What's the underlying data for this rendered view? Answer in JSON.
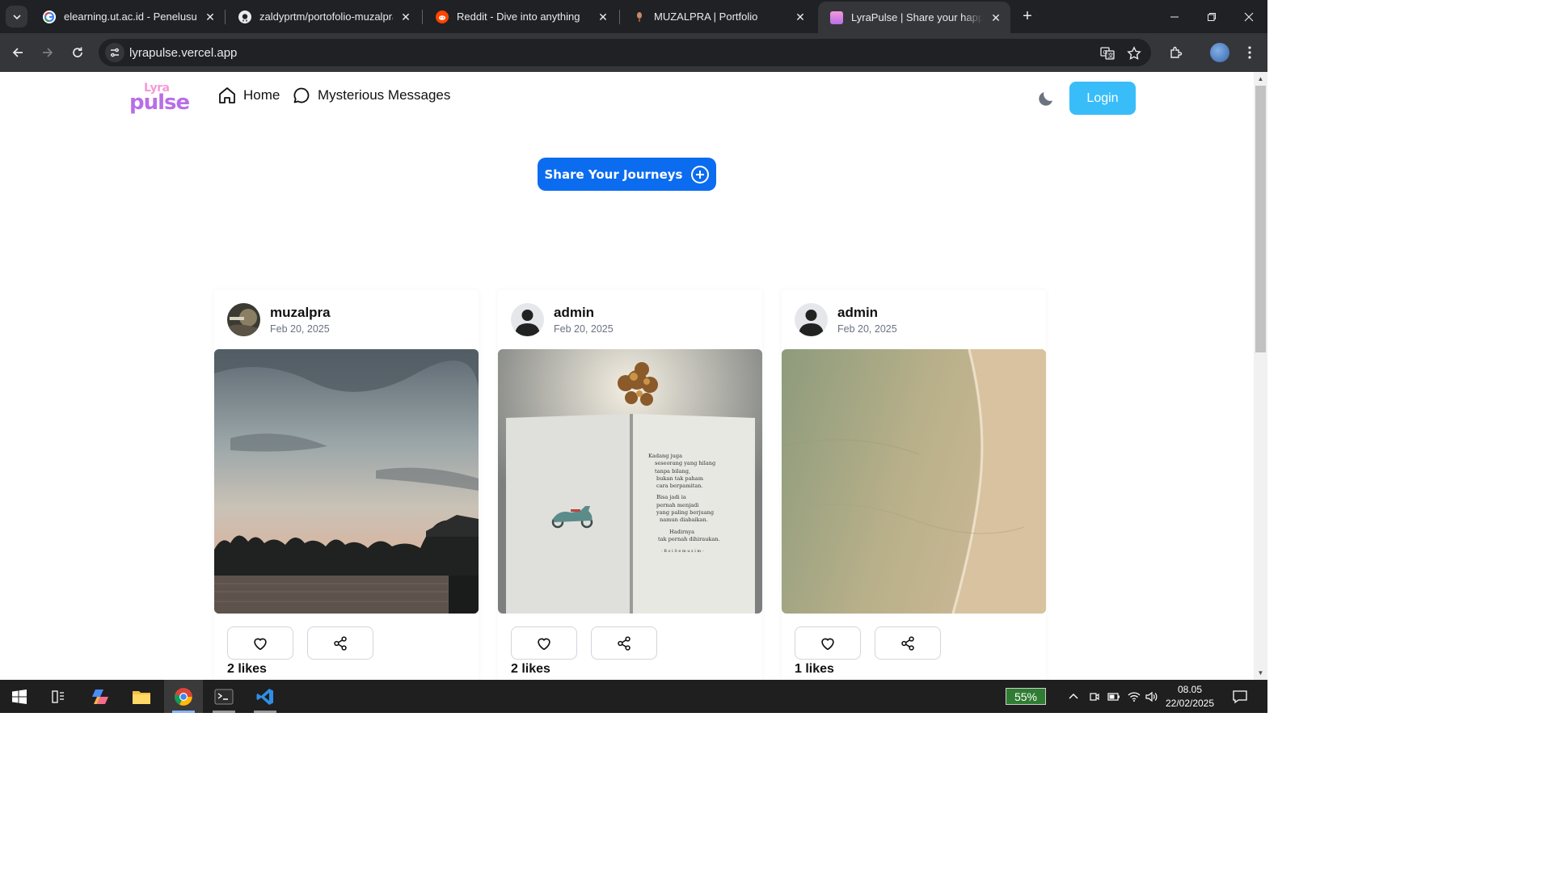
{
  "browser": {
    "tabs": [
      {
        "title": "elearning.ut.ac.id - Penelusuran",
        "favicon": "google-icon"
      },
      {
        "title": "zaldyprtm/portofolio-muzalpra",
        "favicon": "github-icon"
      },
      {
        "title": "Reddit - Dive into anything",
        "favicon": "reddit-icon"
      },
      {
        "title": "MUZALPRA | Portfolio",
        "favicon": "portfolio-icon"
      },
      {
        "title": "LyraPulse | Share your happines",
        "favicon": "lyrapulse-icon",
        "active": true
      }
    ],
    "url": "lyrapulse.vercel.app"
  },
  "site": {
    "logo_top": "Lyra",
    "logo_bottom": "pulse",
    "nav": {
      "home": "Home",
      "messages": "Mysterious Messages"
    },
    "login_label": "Login",
    "share_label": "Share Your Journeys"
  },
  "posts": [
    {
      "username": "muzalpra",
      "date": "Feb 20, 2025",
      "likes": "2 likes",
      "image": "sunset-beach-photo"
    },
    {
      "username": "admin",
      "date": "Feb 20, 2025",
      "likes": "2 likes",
      "image": "open-book-poem-photo"
    },
    {
      "username": "admin",
      "date": "Feb 20, 2025",
      "likes": "1 likes",
      "image": "aerial-shore-photo"
    }
  ],
  "poem_lines": [
    "Kadang juga",
    "seseorang yang hilang",
    "tanpa bilang,",
    "bukan tak paham",
    "cara berpamitan.",
    "Bisa jadi ia",
    "pernah menjadi",
    "yang paling berjuang",
    "namun diabaikan.",
    "Hadirnya",
    "tak pernah dihiraukan.",
    "- B o i  S e m u s i m -"
  ],
  "taskbar": {
    "battery": "55%",
    "time": "08.05",
    "date": "22/02/2025"
  },
  "colors": {
    "login": "#38bdf8",
    "share": "#0b6cf0",
    "logo": "#b96ee8"
  }
}
